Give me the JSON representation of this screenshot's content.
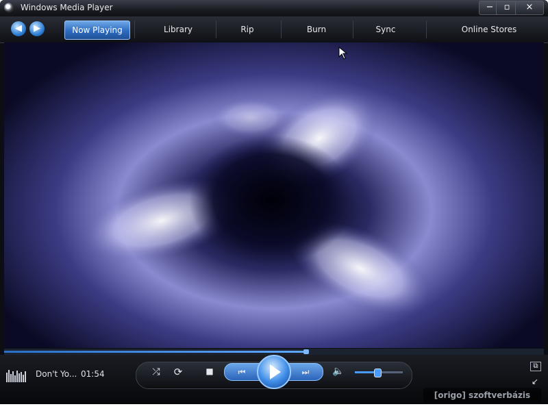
{
  "window": {
    "title": "Windows Media Player"
  },
  "title_buttons": {
    "minimize": "−",
    "maximize": "▫",
    "close": "×"
  },
  "nav": {
    "back_icon": "back-arrow-icon",
    "forward_icon": "forward-arrow-icon",
    "tabs": [
      {
        "label": "Now Playing",
        "active": true
      },
      {
        "label": "Library",
        "active": false
      },
      {
        "label": "Rip",
        "active": false
      },
      {
        "label": "Burn",
        "active": false
      },
      {
        "label": "Sync",
        "active": false
      },
      {
        "label": "Online Stores",
        "active": false
      }
    ]
  },
  "playback": {
    "track_title": "Don't Yo...",
    "elapsed": "01:54",
    "seek_progress": 0.56,
    "volume": 0.45
  },
  "controls": {
    "shuffle": "⤮",
    "repeat": "⟳",
    "stop": "■",
    "previous": "⏮",
    "play": "▶",
    "next": "⏭",
    "mute": "🔈",
    "fullscreen": "⧉",
    "mini_mode": "↙"
  },
  "watermark": {
    "text": "[origo] szoftverbázis"
  },
  "colors": {
    "accent": "#2e6cc0",
    "viz_primary": "#8a8ad0"
  }
}
